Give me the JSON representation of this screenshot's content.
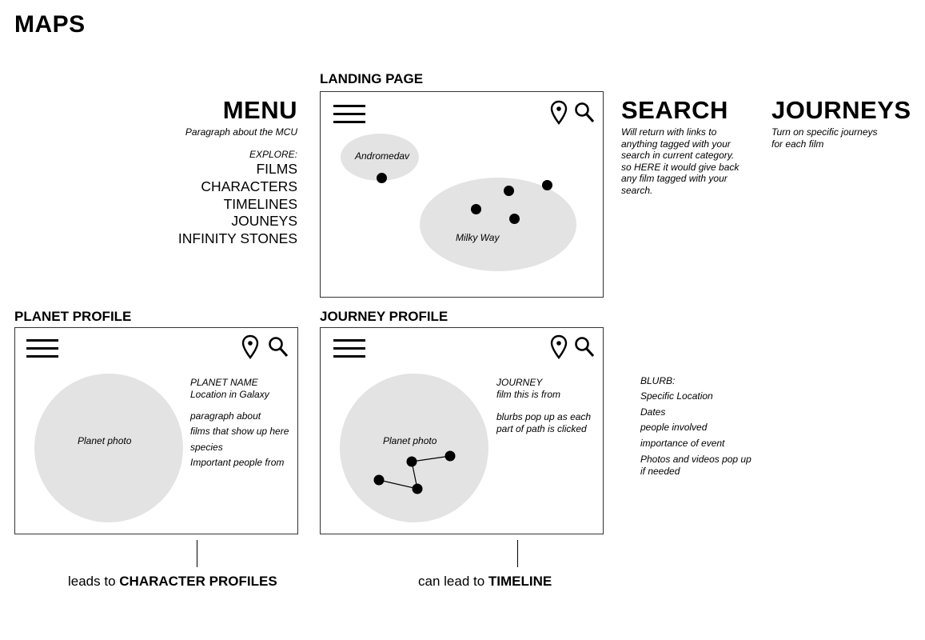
{
  "page": {
    "title": "MAPS"
  },
  "menu": {
    "heading": "MENU",
    "paragraph": "Paragraph about the MCU",
    "explore_label": "EXPLORE:",
    "items": [
      "FILMS",
      "CHARACTERS",
      "TIMELINES",
      "JOUNEYS",
      "INFINITY STONES"
    ]
  },
  "landing": {
    "label": "LANDING PAGE",
    "galaxy_small": "Andromedav",
    "galaxy_large": "Milky Way"
  },
  "search": {
    "heading": "SEARCH",
    "description": "Will return with links to\nanything tagged with your\nsearch in current category.\nso HERE it would give back\nany film tagged with your\nsearch."
  },
  "journeys": {
    "heading": "JOURNEYS",
    "description": "Turn on specific journeys\nfor each film"
  },
  "planet_profile": {
    "label": "PLANET PROFILE",
    "photo_label": "Planet photo",
    "name_text": "PLANET NAME\nLocation in Galaxy",
    "details": [
      "paragraph about",
      "films that show up here",
      "species",
      "Important people from"
    ]
  },
  "journey_profile": {
    "label": "JOURNEY PROFILE",
    "photo_label": "Planet photo",
    "journey_text": "JOURNEY\nfilm this is from",
    "blurb_text": "blurbs pop up as each\npart of path is clicked"
  },
  "blurb": {
    "label": "BLURB:",
    "items": [
      "Specific Location",
      "Dates",
      "people involved",
      "importance of event"
    ],
    "last_item": "Photos and videos pop up\nif needed"
  },
  "footers": {
    "left_prefix": "leads to ",
    "left_bold": "CHARACTER PROFILES",
    "right_prefix": "can lead to ",
    "right_bold": "TIMELINE"
  },
  "icons": [
    "hamburger-menu-icon",
    "map-pin-icon",
    "search-icon"
  ]
}
